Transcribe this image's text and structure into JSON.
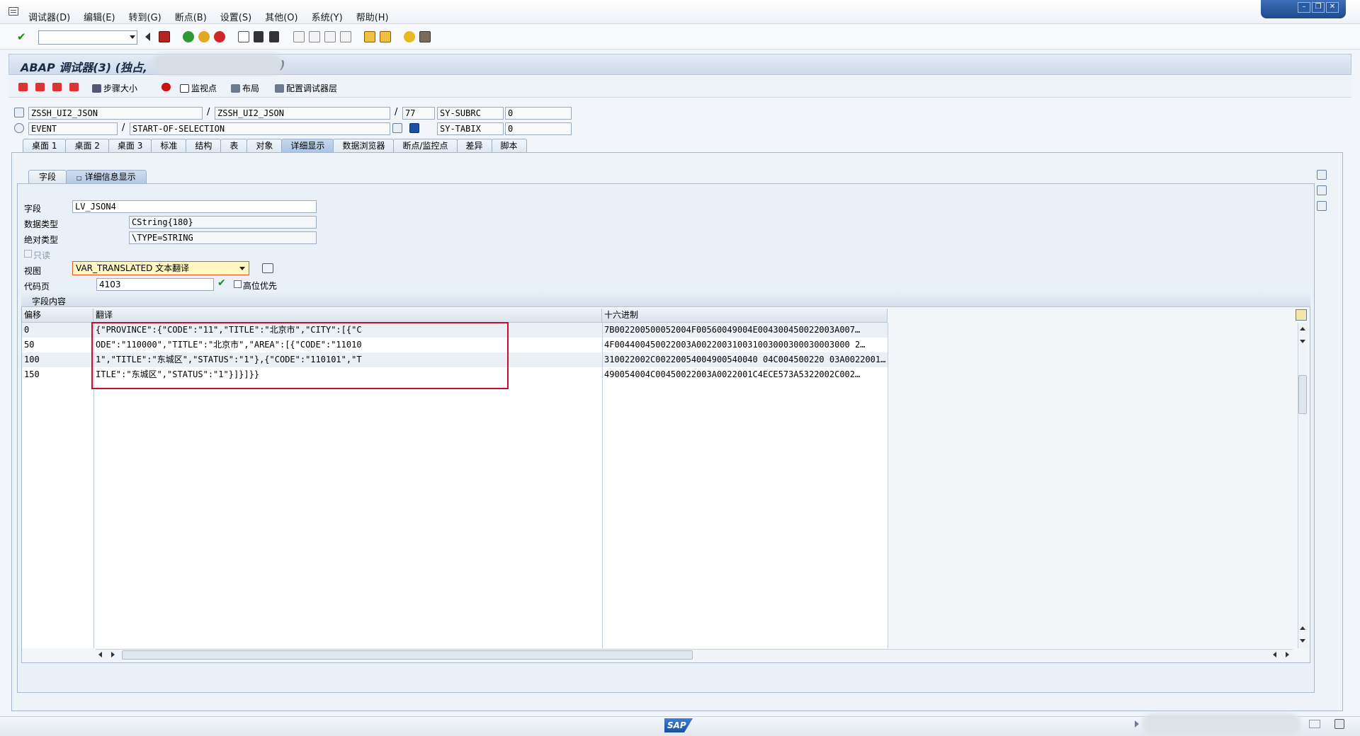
{
  "menu": [
    "调试器(D)",
    "编辑(E)",
    "转到(G)",
    "断点(B)",
    "设置(S)",
    "其他(O)",
    "系统(Y)",
    "帮助(H)"
  ],
  "title": "ABAP 调试器(3) (独占,",
  "title_tail": ")",
  "app_toolbar": {
    "step_size": "步骤大小",
    "watchpoint": "监视点",
    "layout": "布局",
    "config_layers": "配置调试器层"
  },
  "source": {
    "program": "ZSSH_UI2_JSON",
    "include": "ZSSH_UI2_JSON",
    "line": "77",
    "event_type": "EVENT",
    "event_name": "START-OF-SELECTION",
    "sy_subrc_label": "SY-SUBRC",
    "sy_subrc_value": "0",
    "sy_tabix_label": "SY-TABIX",
    "sy_tabix_value": "0"
  },
  "tabs": [
    "桌面 1",
    "桌面 2",
    "桌面 3",
    "标准",
    "结构",
    "表",
    "对象",
    "详细显示",
    "数据浏览器",
    "断点/监控点",
    "差异",
    "脚本"
  ],
  "active_tab": "详细显示",
  "subtabs": [
    "字段",
    "详细信息显示"
  ],
  "detail": {
    "field_label": "字段",
    "field_value": "LV_JSON4",
    "datatype_label": "数据类型",
    "datatype_value": "CString{180}",
    "abstype_label": "绝对类型",
    "abstype_value": "\\TYPE=STRING",
    "readonly_label": "只读",
    "view_label": "视图",
    "view_value": "VAR_TRANSLATED 文本翻译",
    "codepage_label": "代码页",
    "codepage_value": "4103",
    "highbyte_label": "高位优先"
  },
  "content": {
    "group_title": "字段内容",
    "headers": [
      "偏移",
      "翻译",
      "十六进制"
    ],
    "rows": [
      {
        "offset": "0",
        "text": "{\"PROVINCE\":{\"CODE\":\"11\",\"TITLE\":\"北京市\",\"CITY\":[{\"C",
        "hex": "7B002200500052004F00560049004E004300450022003A007…"
      },
      {
        "offset": "50",
        "text": "ODE\":\"110000\",\"TITLE\":\"北京市\",\"AREA\":[{\"CODE\":\"11010",
        "hex": "4F004400450022003A002200310031003000300030003000 2…"
      },
      {
        "offset": "100",
        "text": "1\",\"TITLE\":\"东城区\",\"STATUS\":\"1\"},{\"CODE\":\"110101\",\"T",
        "hex": "310022002C00220054004900540040 04C004500220 03A0022001…"
      },
      {
        "offset": "150",
        "text": "ITLE\":\"东城区\",\"STATUS\":\"1\"}]}]}}",
        "hex": "490054004C00450022003A0022001C4ECE573A5322002C002…"
      }
    ]
  },
  "status": {
    "logo": "SAP"
  }
}
